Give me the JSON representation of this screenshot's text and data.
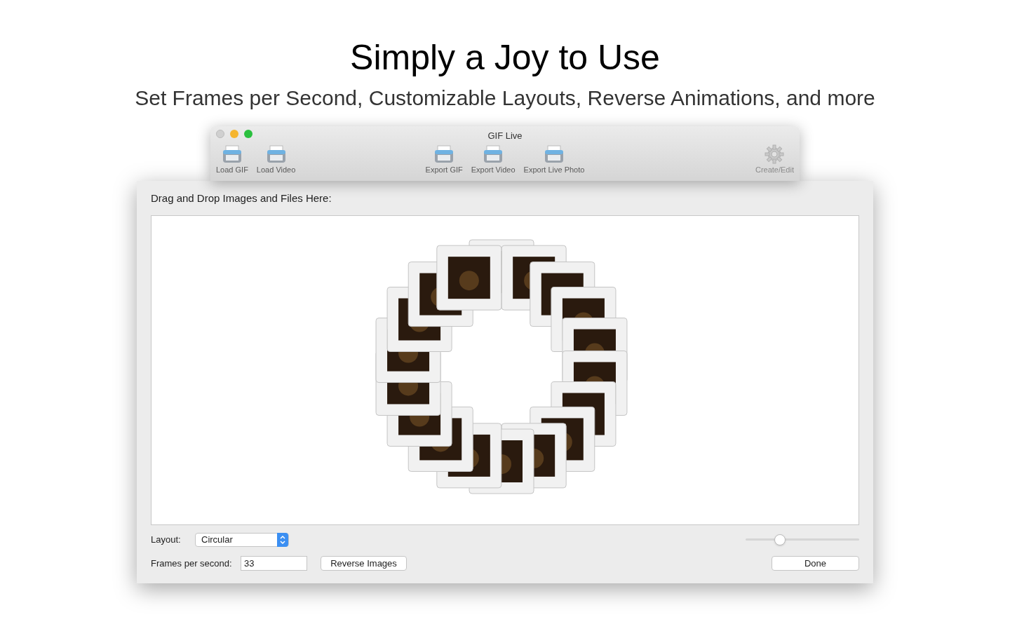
{
  "headline": "Simply a Joy to Use",
  "subheadline": "Set Frames per Second, Customizable Layouts, Reverse Animations, and more",
  "window": {
    "title": "GIF Live"
  },
  "toolbar_left": [
    {
      "label": "Load GIF",
      "kind": "tray",
      "disabled": false
    },
    {
      "label": "Load Video",
      "kind": "tray",
      "disabled": false
    }
  ],
  "toolbar_center": [
    {
      "label": "Export GIF",
      "kind": "tray",
      "disabled": false
    },
    {
      "label": "Export Video",
      "kind": "tray",
      "disabled": false
    },
    {
      "label": "Export Live Photo",
      "kind": "tray",
      "disabled": false
    }
  ],
  "toolbar_right": [
    {
      "label": "Create/Edit",
      "kind": "gear",
      "disabled": true
    }
  ],
  "sheet": {
    "drop_label": "Drag and Drop Images and Files Here:",
    "layout_label": "Layout:",
    "layout_value": "Circular",
    "size_slider": {
      "level": 0.3
    },
    "fps_label": "Frames per second:",
    "fps_value": "33",
    "reverse_button": "Reverse Images",
    "done_button": "Done"
  }
}
